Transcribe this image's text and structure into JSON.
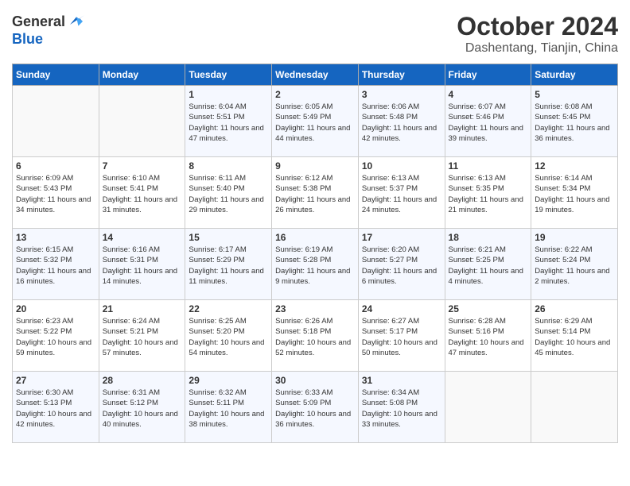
{
  "header": {
    "logo_general": "General",
    "logo_blue": "Blue",
    "month": "October 2024",
    "location": "Dashentang, Tianjin, China"
  },
  "weekdays": [
    "Sunday",
    "Monday",
    "Tuesday",
    "Wednesday",
    "Thursday",
    "Friday",
    "Saturday"
  ],
  "weeks": [
    [
      {
        "day": "",
        "sunrise": "",
        "sunset": "",
        "daylight": ""
      },
      {
        "day": "",
        "sunrise": "",
        "sunset": "",
        "daylight": ""
      },
      {
        "day": "1",
        "sunrise": "Sunrise: 6:04 AM",
        "sunset": "Sunset: 5:51 PM",
        "daylight": "Daylight: 11 hours and 47 minutes."
      },
      {
        "day": "2",
        "sunrise": "Sunrise: 6:05 AM",
        "sunset": "Sunset: 5:49 PM",
        "daylight": "Daylight: 11 hours and 44 minutes."
      },
      {
        "day": "3",
        "sunrise": "Sunrise: 6:06 AM",
        "sunset": "Sunset: 5:48 PM",
        "daylight": "Daylight: 11 hours and 42 minutes."
      },
      {
        "day": "4",
        "sunrise": "Sunrise: 6:07 AM",
        "sunset": "Sunset: 5:46 PM",
        "daylight": "Daylight: 11 hours and 39 minutes."
      },
      {
        "day": "5",
        "sunrise": "Sunrise: 6:08 AM",
        "sunset": "Sunset: 5:45 PM",
        "daylight": "Daylight: 11 hours and 36 minutes."
      }
    ],
    [
      {
        "day": "6",
        "sunrise": "Sunrise: 6:09 AM",
        "sunset": "Sunset: 5:43 PM",
        "daylight": "Daylight: 11 hours and 34 minutes."
      },
      {
        "day": "7",
        "sunrise": "Sunrise: 6:10 AM",
        "sunset": "Sunset: 5:41 PM",
        "daylight": "Daylight: 11 hours and 31 minutes."
      },
      {
        "day": "8",
        "sunrise": "Sunrise: 6:11 AM",
        "sunset": "Sunset: 5:40 PM",
        "daylight": "Daylight: 11 hours and 29 minutes."
      },
      {
        "day": "9",
        "sunrise": "Sunrise: 6:12 AM",
        "sunset": "Sunset: 5:38 PM",
        "daylight": "Daylight: 11 hours and 26 minutes."
      },
      {
        "day": "10",
        "sunrise": "Sunrise: 6:13 AM",
        "sunset": "Sunset: 5:37 PM",
        "daylight": "Daylight: 11 hours and 24 minutes."
      },
      {
        "day": "11",
        "sunrise": "Sunrise: 6:13 AM",
        "sunset": "Sunset: 5:35 PM",
        "daylight": "Daylight: 11 hours and 21 minutes."
      },
      {
        "day": "12",
        "sunrise": "Sunrise: 6:14 AM",
        "sunset": "Sunset: 5:34 PM",
        "daylight": "Daylight: 11 hours and 19 minutes."
      }
    ],
    [
      {
        "day": "13",
        "sunrise": "Sunrise: 6:15 AM",
        "sunset": "Sunset: 5:32 PM",
        "daylight": "Daylight: 11 hours and 16 minutes."
      },
      {
        "day": "14",
        "sunrise": "Sunrise: 6:16 AM",
        "sunset": "Sunset: 5:31 PM",
        "daylight": "Daylight: 11 hours and 14 minutes."
      },
      {
        "day": "15",
        "sunrise": "Sunrise: 6:17 AM",
        "sunset": "Sunset: 5:29 PM",
        "daylight": "Daylight: 11 hours and 11 minutes."
      },
      {
        "day": "16",
        "sunrise": "Sunrise: 6:19 AM",
        "sunset": "Sunset: 5:28 PM",
        "daylight": "Daylight: 11 hours and 9 minutes."
      },
      {
        "day": "17",
        "sunrise": "Sunrise: 6:20 AM",
        "sunset": "Sunset: 5:27 PM",
        "daylight": "Daylight: 11 hours and 6 minutes."
      },
      {
        "day": "18",
        "sunrise": "Sunrise: 6:21 AM",
        "sunset": "Sunset: 5:25 PM",
        "daylight": "Daylight: 11 hours and 4 minutes."
      },
      {
        "day": "19",
        "sunrise": "Sunrise: 6:22 AM",
        "sunset": "Sunset: 5:24 PM",
        "daylight": "Daylight: 11 hours and 2 minutes."
      }
    ],
    [
      {
        "day": "20",
        "sunrise": "Sunrise: 6:23 AM",
        "sunset": "Sunset: 5:22 PM",
        "daylight": "Daylight: 10 hours and 59 minutes."
      },
      {
        "day": "21",
        "sunrise": "Sunrise: 6:24 AM",
        "sunset": "Sunset: 5:21 PM",
        "daylight": "Daylight: 10 hours and 57 minutes."
      },
      {
        "day": "22",
        "sunrise": "Sunrise: 6:25 AM",
        "sunset": "Sunset: 5:20 PM",
        "daylight": "Daylight: 10 hours and 54 minutes."
      },
      {
        "day": "23",
        "sunrise": "Sunrise: 6:26 AM",
        "sunset": "Sunset: 5:18 PM",
        "daylight": "Daylight: 10 hours and 52 minutes."
      },
      {
        "day": "24",
        "sunrise": "Sunrise: 6:27 AM",
        "sunset": "Sunset: 5:17 PM",
        "daylight": "Daylight: 10 hours and 50 minutes."
      },
      {
        "day": "25",
        "sunrise": "Sunrise: 6:28 AM",
        "sunset": "Sunset: 5:16 PM",
        "daylight": "Daylight: 10 hours and 47 minutes."
      },
      {
        "day": "26",
        "sunrise": "Sunrise: 6:29 AM",
        "sunset": "Sunset: 5:14 PM",
        "daylight": "Daylight: 10 hours and 45 minutes."
      }
    ],
    [
      {
        "day": "27",
        "sunrise": "Sunrise: 6:30 AM",
        "sunset": "Sunset: 5:13 PM",
        "daylight": "Daylight: 10 hours and 42 minutes."
      },
      {
        "day": "28",
        "sunrise": "Sunrise: 6:31 AM",
        "sunset": "Sunset: 5:12 PM",
        "daylight": "Daylight: 10 hours and 40 minutes."
      },
      {
        "day": "29",
        "sunrise": "Sunrise: 6:32 AM",
        "sunset": "Sunset: 5:11 PM",
        "daylight": "Daylight: 10 hours and 38 minutes."
      },
      {
        "day": "30",
        "sunrise": "Sunrise: 6:33 AM",
        "sunset": "Sunset: 5:09 PM",
        "daylight": "Daylight: 10 hours and 36 minutes."
      },
      {
        "day": "31",
        "sunrise": "Sunrise: 6:34 AM",
        "sunset": "Sunset: 5:08 PM",
        "daylight": "Daylight: 10 hours and 33 minutes."
      },
      {
        "day": "",
        "sunrise": "",
        "sunset": "",
        "daylight": ""
      },
      {
        "day": "",
        "sunrise": "",
        "sunset": "",
        "daylight": ""
      }
    ]
  ]
}
